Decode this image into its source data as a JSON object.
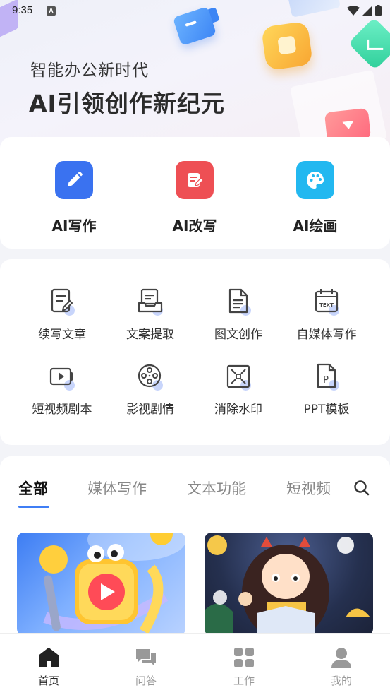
{
  "status": {
    "time": "9:35",
    "badge": "A"
  },
  "hero": {
    "subtitle": "智能办公新时代",
    "title": "AI引领创作新纪元"
  },
  "ai_tools": [
    {
      "label": "AI写作",
      "icon": "pencil-icon",
      "color": "#3a72f0"
    },
    {
      "label": "AI改写",
      "icon": "edit-doc-icon",
      "color": "#ee4f54"
    },
    {
      "label": "AI绘画",
      "icon": "palette-icon",
      "color": "#22b8f0"
    }
  ],
  "tools": [
    {
      "label": "续写文章",
      "icon": "continue-writing-icon"
    },
    {
      "label": "文案提取",
      "icon": "copy-extract-icon"
    },
    {
      "label": "图文创作",
      "icon": "image-text-doc-icon"
    },
    {
      "label": "自媒体写作",
      "icon": "text-calendar-icon"
    },
    {
      "label": "短视频剧本",
      "icon": "video-script-icon"
    },
    {
      "label": "影视剧情",
      "icon": "film-reel-icon"
    },
    {
      "label": "消除水印",
      "icon": "remove-watermark-icon"
    },
    {
      "label": "PPT模板",
      "icon": "ppt-file-icon"
    }
  ],
  "tools_extra": {
    "text_badge": "TEXT",
    "ppt_badge": "P"
  },
  "tabs": [
    {
      "label": "全部",
      "active": true
    },
    {
      "label": "媒体写作",
      "active": false
    },
    {
      "label": "文本功能",
      "active": false
    },
    {
      "label": "短视频",
      "active": false
    }
  ],
  "nav": [
    {
      "label": "首页",
      "icon": "home-icon",
      "active": true
    },
    {
      "label": "问答",
      "icon": "chat-icon",
      "active": false
    },
    {
      "label": "工作",
      "icon": "grid-icon",
      "active": false
    },
    {
      "label": "我的",
      "icon": "user-icon",
      "active": false
    }
  ],
  "colors": {
    "accent": "#3f7ef5",
    "nav_active": "#222222",
    "nav_inactive": "#999999"
  }
}
